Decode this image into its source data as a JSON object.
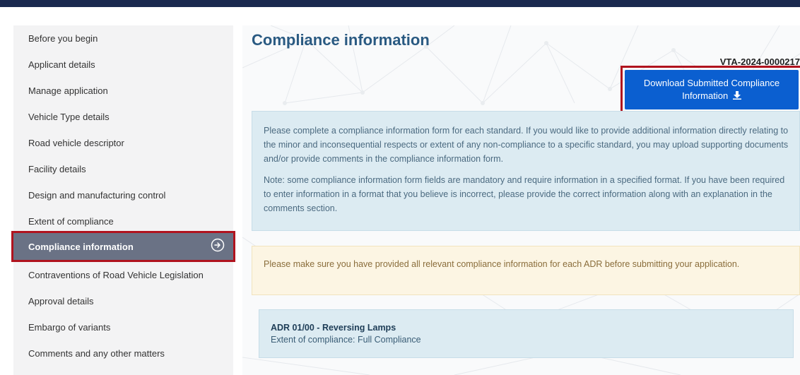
{
  "sidebar": {
    "items": [
      {
        "label": "Before you begin",
        "active": false
      },
      {
        "label": "Applicant details",
        "active": false
      },
      {
        "label": "Manage application",
        "active": false
      },
      {
        "label": "Vehicle Type details",
        "active": false
      },
      {
        "label": "Road vehicle descriptor",
        "active": false
      },
      {
        "label": "Facility details",
        "active": false
      },
      {
        "label": "Design and manufacturing control",
        "active": false
      },
      {
        "label": "Extent of compliance",
        "active": false
      },
      {
        "label": "Compliance information",
        "active": true,
        "icon": "arrow-circle-right-icon"
      },
      {
        "label": "Contraventions of Road Vehicle Legislation",
        "active": false
      },
      {
        "label": "Approval details",
        "active": false
      },
      {
        "label": "Embargo of variants",
        "active": false
      },
      {
        "label": "Comments and any other matters",
        "active": false
      }
    ]
  },
  "main": {
    "title": "Compliance information",
    "reference": "VTA-2024-0000217",
    "download_button": {
      "label_line1": "Download Submitted Compliance",
      "label_line2": "Information",
      "icon": "download-icon"
    },
    "info_box": {
      "para1": "Please complete a compliance information form for each standard. If you would like to provide additional information directly relating to the minor and inconsequential respects or extent of any non-compliance to a specific standard, you may upload supporting documents and/or provide comments in the compliance information form.",
      "para2": "Note: some compliance information form fields are mandatory and require information in a specified format. If you have been required to enter information in a format that you believe is incorrect, please provide the correct information along with an explanation in the comments section."
    },
    "warning_box": {
      "text": "Please make sure you have provided all relevant compliance information for each ADR before submitting your application."
    },
    "adr_card": {
      "title": "ADR 01/00 - Reversing Lamps",
      "extent": "Extent of compliance: Full Compliance"
    }
  },
  "colors": {
    "header": "#1a2a4f",
    "active_nav": "#6a7285",
    "highlight_border": "#b0131e",
    "primary_button": "#0b5fd0",
    "title": "#2a5a82"
  }
}
